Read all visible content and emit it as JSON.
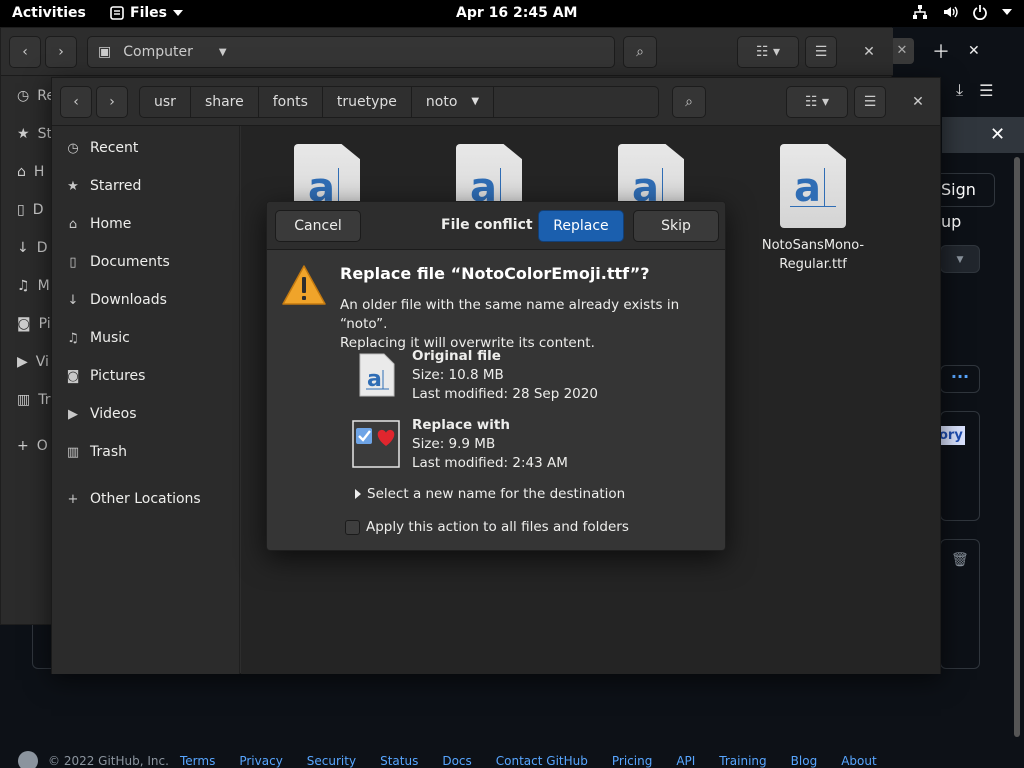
{
  "topbar": {
    "activities": "Activities",
    "app_name": "Files",
    "clock": "Apr 16   2:45 AM"
  },
  "browser": {
    "signup": "Sign up",
    "partial_link": "ory",
    "footer": {
      "copyright": "© 2022 GitHub, Inc.",
      "links": [
        "Terms",
        "Privacy",
        "Security",
        "Status",
        "Docs",
        "Contact GitHub",
        "Pricing",
        "API",
        "Training",
        "Blog",
        "About"
      ]
    }
  },
  "bg_files": {
    "location": "Computer",
    "sidebar_letters": [
      "Re",
      "St",
      "H",
      "D",
      "D",
      "M",
      "Pi",
      "Vi",
      "Tr",
      "O"
    ]
  },
  "files": {
    "path": [
      "usr",
      "share",
      "fonts",
      "truetype",
      "noto"
    ],
    "sidebar": [
      {
        "label": "Recent",
        "icon": "clock-icon"
      },
      {
        "label": "Starred",
        "icon": "star-icon"
      },
      {
        "label": "Home",
        "icon": "home-icon"
      },
      {
        "label": "Documents",
        "icon": "document-icon"
      },
      {
        "label": "Downloads",
        "icon": "download-icon"
      },
      {
        "label": "Music",
        "icon": "music-icon"
      },
      {
        "label": "Pictures",
        "icon": "camera-icon"
      },
      {
        "label": "Videos",
        "icon": "video-icon"
      },
      {
        "label": "Trash",
        "icon": "trash-icon"
      },
      {
        "label": "Other Locations",
        "icon": "plus-icon"
      }
    ],
    "visible_file_name": "NotoSansMono-Regular.ttf",
    "file_name_line1": "NotoSansMono-",
    "file_name_line2": "Regular.ttf"
  },
  "conflict": {
    "cancel": "Cancel",
    "title": "File conflict",
    "replace": "Replace",
    "skip": "Skip",
    "headline": "Replace file “NotoColorEmoji.ttf”?",
    "desc_line1": "An older file with the same name already exists in “noto”.",
    "desc_line2": "Replacing it will overwrite its content.",
    "original": {
      "heading": "Original file",
      "size": "Size: 10.8 MB",
      "modified": "Last modified: 28 Sep 2020"
    },
    "replacement": {
      "heading": "Replace with",
      "size": "Size: 9.9 MB",
      "modified": "Last modified:  2:43 AM"
    },
    "rename_expander": "Select a new name for the destination",
    "apply_all": "Apply this action to all files and folders"
  },
  "colors": {
    "accent": "#1b5fae",
    "warning": "#f0a42a",
    "link": "#58a6ff"
  }
}
